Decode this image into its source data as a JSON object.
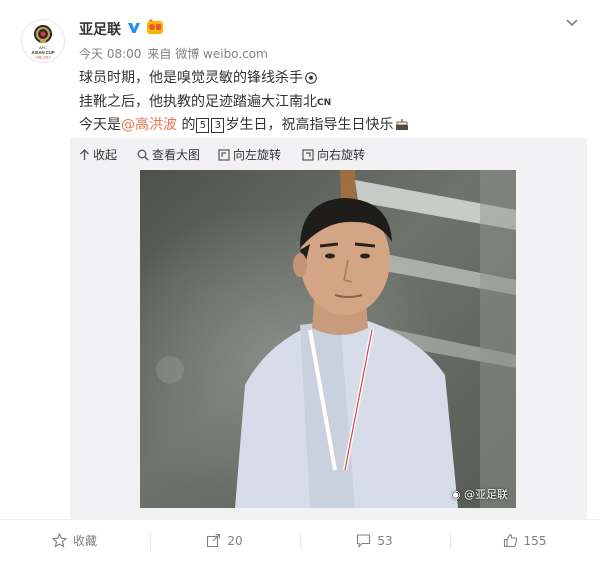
{
  "account": {
    "name": "亚足联",
    "avatar_text": "AFC ASIAN CUP",
    "avatar_subtext": "UAE 2019"
  },
  "meta": {
    "time": "今天 08:00",
    "source": "来自 微博 weibo.com"
  },
  "post": {
    "line1": "球员时期，他是嗅觉灵敏的锋线杀手",
    "line2": "挂靴之后，他执教的足迹踏遍大江南北",
    "line2_badge": "CN",
    "line3_prefix": "今天是",
    "mention": "@高洪波",
    "line3_mid": " 的",
    "age_digits": [
      "5",
      "3"
    ],
    "line3_suffix": "岁生日，祝高指导生日快乐"
  },
  "media_toolbar": {
    "collapse": "收起",
    "view_large": "查看大图",
    "rotate_left": "向左旋转",
    "rotate_right": "向右旋转"
  },
  "image": {
    "watermark": "@亚足联"
  },
  "actions": {
    "favorite": "收藏",
    "repost": "20",
    "comment": "53",
    "like": "155"
  },
  "colors": {
    "mention": "#eb7350",
    "verified": "#2b8cf0",
    "text": "#333333",
    "meta": "#808080",
    "panel": "#f2f2f5"
  }
}
